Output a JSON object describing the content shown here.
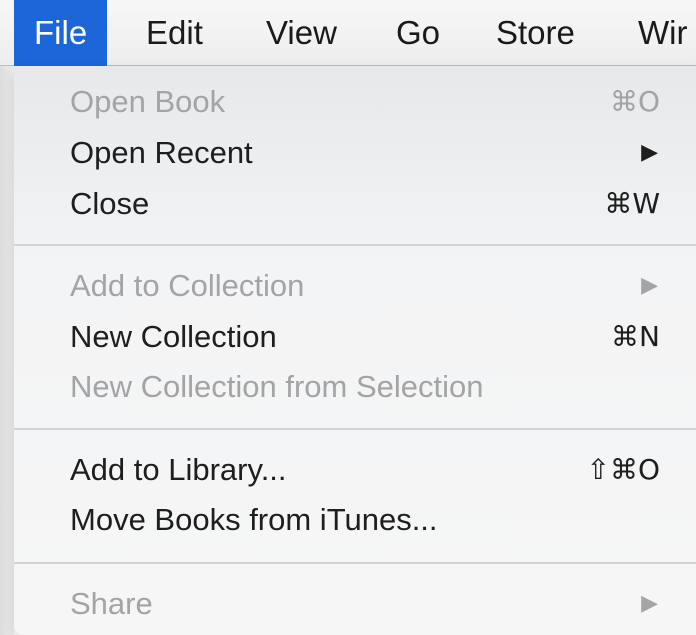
{
  "menubar": {
    "items": [
      {
        "label": "File",
        "active": true
      },
      {
        "label": "Edit"
      },
      {
        "label": "View"
      },
      {
        "label": "Go"
      },
      {
        "label": "Store"
      },
      {
        "label": "Wir"
      }
    ]
  },
  "file_menu": {
    "sections": [
      [
        {
          "label": "Open Book",
          "shortcut": "⌘O",
          "enabled": false
        },
        {
          "label": "Open Recent",
          "submenu_arrow": "▶",
          "enabled": true
        },
        {
          "label": "Close",
          "shortcut": "⌘W",
          "enabled": true
        }
      ],
      [
        {
          "label": "Add to Collection",
          "submenu_arrow": "▶",
          "enabled": false
        },
        {
          "label": "New Collection",
          "shortcut": "⌘N",
          "enabled": true
        },
        {
          "label": "New Collection from Selection",
          "enabled": false
        }
      ],
      [
        {
          "label": "Add to Library...",
          "shortcut": "⇧⌘O",
          "enabled": true
        },
        {
          "label": "Move Books from iTunes...",
          "enabled": true
        }
      ],
      [
        {
          "label": "Share",
          "submenu_arrow": "▶",
          "enabled": false
        }
      ]
    ]
  },
  "colors": {
    "accent": "#1c66da",
    "enabled_text": "#1e1e1e",
    "disabled_text": "#a4a4a6"
  }
}
